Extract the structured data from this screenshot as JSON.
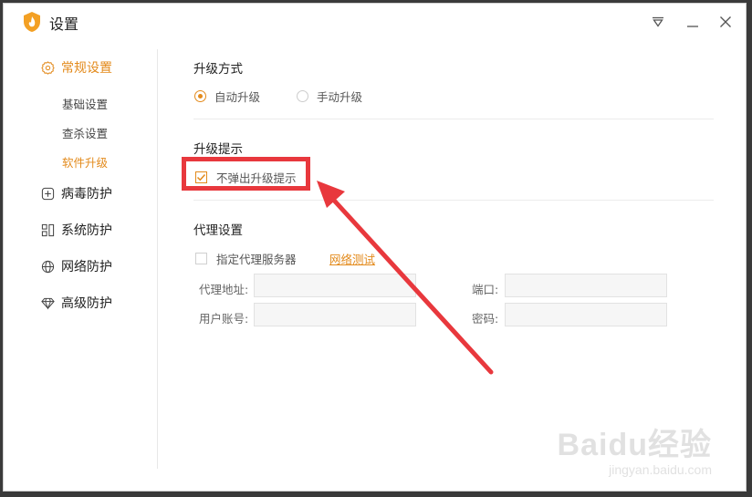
{
  "window": {
    "title": "设置"
  },
  "sidebar": {
    "items": [
      {
        "label": "常规设置",
        "icon": "gear-icon",
        "active": true
      },
      {
        "label": "病毒防护",
        "icon": "plus-box-icon"
      },
      {
        "label": "系统防护",
        "icon": "grid-icon"
      },
      {
        "label": "网络防护",
        "icon": "globe-icon"
      },
      {
        "label": "高级防护",
        "icon": "diamond-icon"
      }
    ],
    "subitems": [
      {
        "label": "基础设置"
      },
      {
        "label": "查杀设置"
      },
      {
        "label": "软件升级",
        "active": true
      }
    ]
  },
  "upgrade_method": {
    "title": "升级方式",
    "options": [
      {
        "label": "自动升级",
        "selected": true
      },
      {
        "label": "手动升级",
        "selected": false
      }
    ]
  },
  "upgrade_notice": {
    "title": "升级提示",
    "checkbox_label": "不弹出升级提示",
    "checked": true
  },
  "proxy": {
    "title": "代理设置",
    "checkbox_label": "指定代理服务器",
    "checked": false,
    "test_link": "网络测试",
    "address_label": "代理地址:",
    "port_label": "端口:",
    "user_label": "用户账号:",
    "password_label": "密码:",
    "address_value": "",
    "port_value": "",
    "user_value": "",
    "password_value": ""
  },
  "watermark": {
    "main": "Baidu经验",
    "sub": "jingyan.baidu.com"
  },
  "colors": {
    "accent": "#e38a1b",
    "annotation": "#e8383d"
  }
}
